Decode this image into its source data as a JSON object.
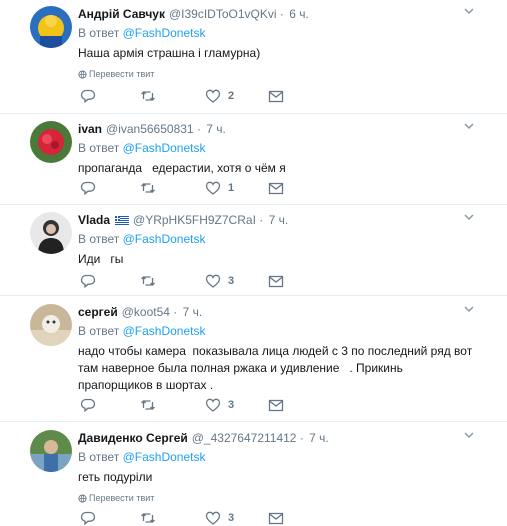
{
  "reply_prefix": "В ответ",
  "translate_label": "Перевести твит",
  "separator": "·",
  "tweets": [
    {
      "name": "Андрій Савчук",
      "handle": "@I39cIDToO1vQKvi",
      "time": "6 ч.",
      "reply_to": "@FashDonetsk",
      "text": "Наша армія страшна і гламурна)",
      "has_translate": true,
      "likes": "2"
    },
    {
      "name": "ivan",
      "handle": "@ivan56650831",
      "time": "7 ч.",
      "reply_to": "@FashDonetsk",
      "text": "пропаганда   едерастии, хотя о чём я",
      "has_translate": false,
      "likes": "1"
    },
    {
      "name": "Vlada",
      "handle": "@YRpHK5FH9Z7CRaI",
      "time": "7 ч.",
      "reply_to": "@FashDonetsk",
      "text": "Иди   гы",
      "has_translate": false,
      "likes": "3",
      "flag": "greece-flag-icon"
    },
    {
      "name": "сергей",
      "handle": "@koot54",
      "time": "7 ч.",
      "reply_to": "@FashDonetsk",
      "text": "надо чтобы камера  показывала лица людей с 3 по последний ряд вот там наверное была полная ржака и удивление   . Прикинь прапорщиков в шортах .",
      "has_translate": false,
      "likes": "3"
    },
    {
      "name": "Давиденко Сергей",
      "handle": "@_4327647211412",
      "time": "7 ч.",
      "reply_to": "@FashDonetsk",
      "text": "геть подурiли",
      "has_translate": true,
      "likes": "3"
    }
  ],
  "colors": {
    "link": "#1da1f2",
    "muted": "#657786",
    "text": "#14171a",
    "divider": "#e6ecf0"
  }
}
